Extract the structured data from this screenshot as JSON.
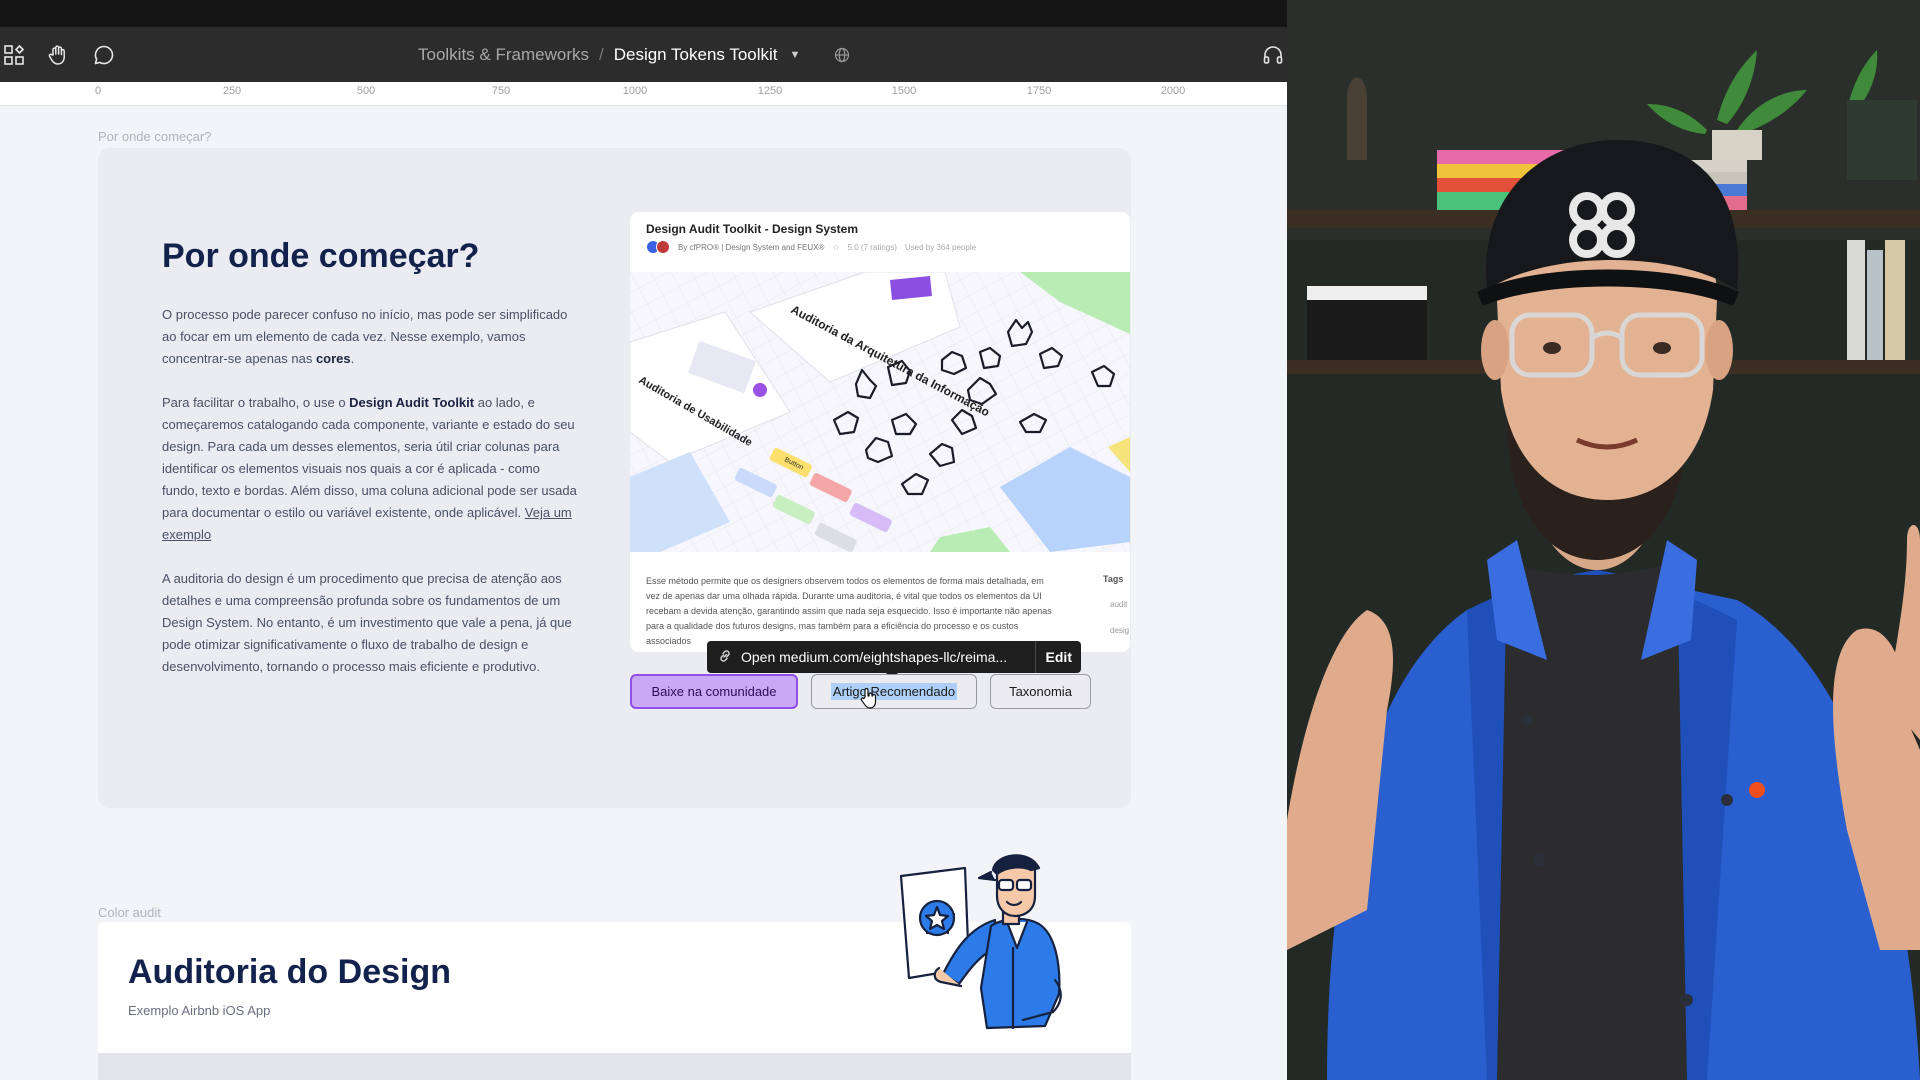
{
  "toolbar": {
    "breadcrumb_parent": "Toolkits & Frameworks",
    "breadcrumb_separator": "/",
    "file_name": "Design Tokens Toolkit"
  },
  "ruler": {
    "marks": [
      "0",
      "250",
      "500",
      "750",
      "1000",
      "1250",
      "1500",
      "1750",
      "2000"
    ]
  },
  "section1": {
    "frame_label": "Por onde começar?",
    "heading": "Por onde começar?",
    "p1_text": "O processo pode parecer confuso no início, mas pode ser simplificado ao focar em um elemento de cada vez. Nesse exemplo, vamos concentrar-se apenas nas ",
    "p1_bold": "cores",
    "p1_end": ".",
    "p2_start": "Para facilitar o trabalho, o use o ",
    "p2_bold": "Design Audit Toolkit",
    "p2_text": " ao lado, e começaremos catalogando cada componente, variante e estado do seu design. Para cada um desses elementos, seria útil criar colunas para identificar os elementos visuais nos quais a cor é aplicada - como fundo, texto e bordas. Além disso, uma coluna adicional pode ser usada para documentar o estilo ou variável existente, onde aplicável. ",
    "p2_link": "Veja um exemplo",
    "p3_text": "A auditoria do design é um procedimento que precisa de atenção aos detalhes e uma compreensão profunda sobre os fundamentos de um Design System. No entanto, é um investimento que vale a pena, já que pode otimizar significativamente o fluxo de trabalho de design e desenvolvimento, tornando o processo mais eficiente e produtivo."
  },
  "preview": {
    "title": "Design Audit Toolkit - Design System",
    "author": "By cfPRO® | Design System and FEUX®",
    "rating": "5.0 (7 ratings)",
    "used_by": "Used by 364 people",
    "cover_texts": {
      "arquitetura": "Auditoria da Arquitetura da Informação",
      "usabilidade": "Auditoria de Usabilidade",
      "button": "Button"
    },
    "description": "Esse método permite que os designers observem todos os elementos de forma mais detalhada, em vez de apenas dar uma olhada rápida. Durante uma auditoria, é vital que todos os elementos da UI recebam a devida atenção, garantindo assim que nada seja esquecido. Isso é importante não apenas para a qualidade dos futuros designs, mas também para a eficiência do processo e os custos associados",
    "tags_title": "Tags",
    "tags": [
      "audit",
      "desig"
    ]
  },
  "tooltip": {
    "link_text": "Open medium.com/eightshapes-llc/reima...",
    "edit_label": "Edit"
  },
  "buttons": {
    "community": "Baixe na comunidade",
    "recommended": "Artigo Recomendado",
    "taxonomy": "Taxonomia"
  },
  "section2": {
    "frame_label": "Color audit",
    "heading": "Auditoria do Design",
    "subtitle": "Exemplo Airbnb iOS App"
  },
  "colors": {
    "heading": "#13224d",
    "primary_button_fill": "#c9a8f7",
    "primary_button_border": "#8f4fe8",
    "selection_highlight": "#aed0f8",
    "jacket_blue": "#2a5fd0"
  }
}
